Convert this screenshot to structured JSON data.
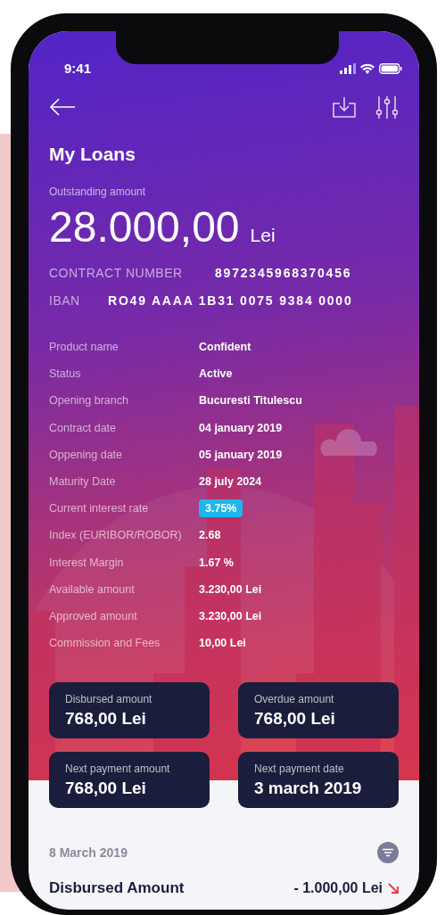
{
  "status_bar": {
    "time": "9:41"
  },
  "header": {
    "title": "My Loans"
  },
  "outstanding": {
    "label": "Outstanding amount",
    "amount": "28.000,00",
    "currency": "Lei"
  },
  "contract": {
    "label": "CONTRACT NUMBER",
    "value": "8972345968370456"
  },
  "iban": {
    "label": "IBAN",
    "value": "RO49 AAAA 1B31 0075 9384 0000"
  },
  "details": [
    {
      "label": "Product name",
      "value": "Confident",
      "kind": "text"
    },
    {
      "label": "Status",
      "value": "Active",
      "kind": "text"
    },
    {
      "label": "Opening branch",
      "value": "Bucuresti Titulescu",
      "kind": "text"
    },
    {
      "label": "Contract date",
      "value": "04 january 2019",
      "kind": "text"
    },
    {
      "label": "Oppening date",
      "value": "05 january 2019",
      "kind": "text"
    },
    {
      "label": "Maturity Date",
      "value": "28 july 2024",
      "kind": "text"
    },
    {
      "label": "Current interest rate",
      "value": "3.75%",
      "kind": "badge"
    },
    {
      "label": "Index (EURIBOR/ROBOR)",
      "value": "2.68",
      "kind": "text"
    },
    {
      "label": "Interest Margin",
      "value": "1.67 %",
      "kind": "text"
    },
    {
      "label": "Available amount",
      "value": "3.230,00 Lei",
      "kind": "text"
    },
    {
      "label": "Approved amount",
      "value": "3.230,00 Lei",
      "kind": "text"
    },
    {
      "label": "Commission and Fees",
      "value": "10,00 Lei",
      "kind": "text"
    }
  ],
  "cards": [
    {
      "label": "Disbursed amount",
      "value": "768,00 Lei"
    },
    {
      "label": "Overdue amount",
      "value": "768,00 Lei"
    },
    {
      "label": "Next payment amount",
      "value": "768,00 Lei"
    },
    {
      "label": "Next payment date",
      "value": "3 march 2019"
    }
  ],
  "transactions": {
    "date": "8 March 2019",
    "items": [
      {
        "title": "Disbursed Amount",
        "amount": "- 1.000,00 Lei",
        "kind": "debit"
      }
    ]
  }
}
